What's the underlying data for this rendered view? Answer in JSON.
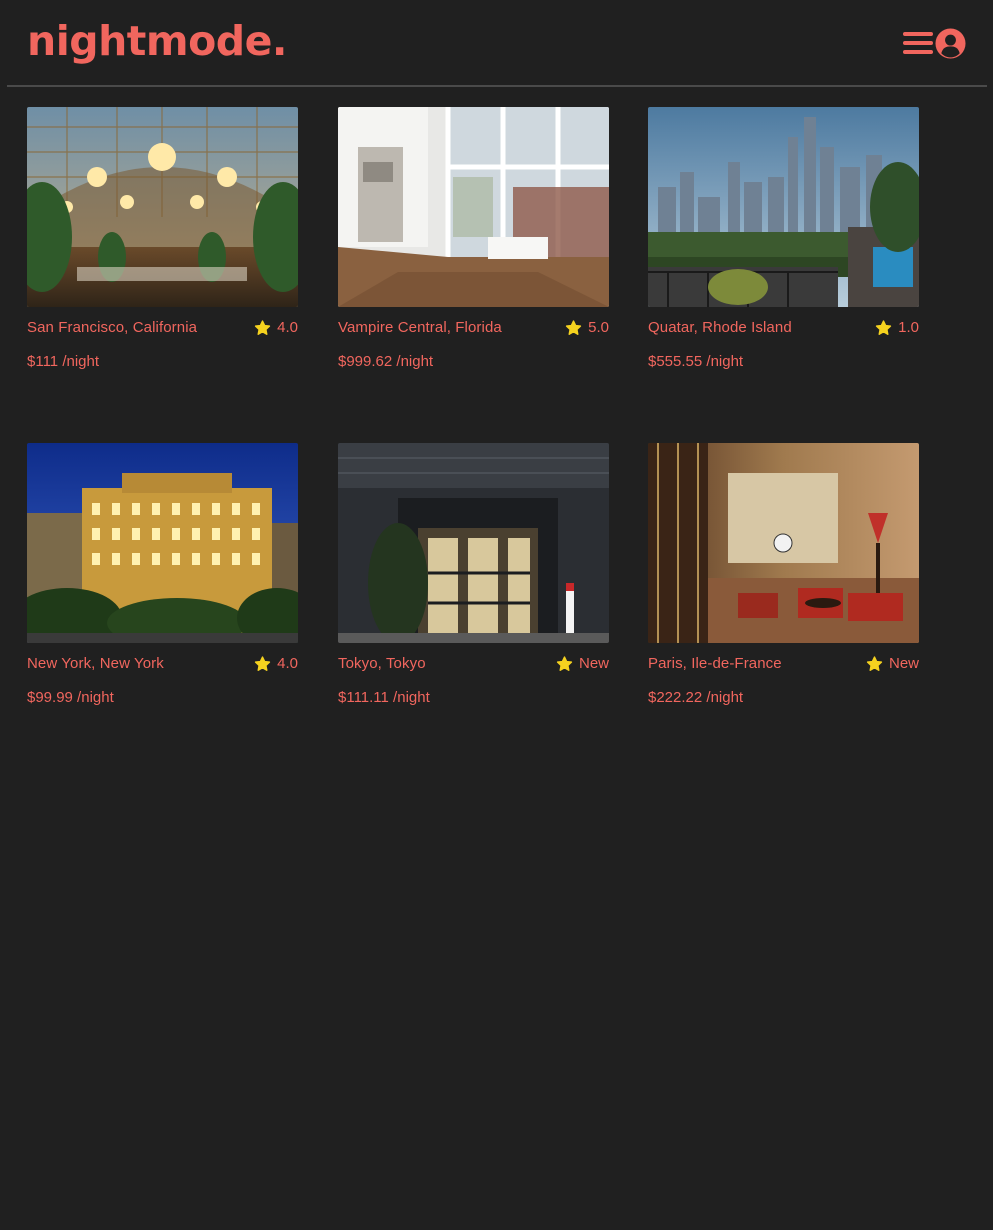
{
  "app": {
    "logo": "nightmode."
  },
  "header": {
    "icons": [
      "hamburger-menu-icon",
      "user-circle-icon"
    ]
  },
  "colors": {
    "background": "#202020",
    "accent": "#f1665e",
    "star": "#f5d21f",
    "divider": "#4a4a4a"
  },
  "listings": [
    {
      "location": "San Francisco, California",
      "rating": "4.0",
      "price": "$111",
      "per_night": " /night",
      "photo": "ornate-glass-dome-hotel-lobby-photo"
    },
    {
      "location": "Vampire Central, Florida",
      "rating": "5.0",
      "price": "$999.62",
      "per_night": " /night",
      "photo": "white-loft-apartment-interior-photo"
    },
    {
      "location": "Quatar, Rhode Island",
      "rating": "1.0",
      "price": "$555.55",
      "per_night": " /night",
      "photo": "city-skyline-balcony-view-photo"
    },
    {
      "location": "New York, New York",
      "rating": "4.0",
      "price": "$99.99",
      "per_night": " /night",
      "photo": "hotel-majestic-night-facade-photo"
    },
    {
      "location": "Tokyo, Tokyo",
      "rating": "New",
      "price": "$111.11",
      "per_night": " /night",
      "photo": "act-hotel-entrance-night-photo"
    },
    {
      "location": "Paris, Ile-de-France",
      "rating": "New",
      "price": "$222.22",
      "per_night": " /night",
      "photo": "art-deco-hotel-lobby-photo"
    }
  ]
}
